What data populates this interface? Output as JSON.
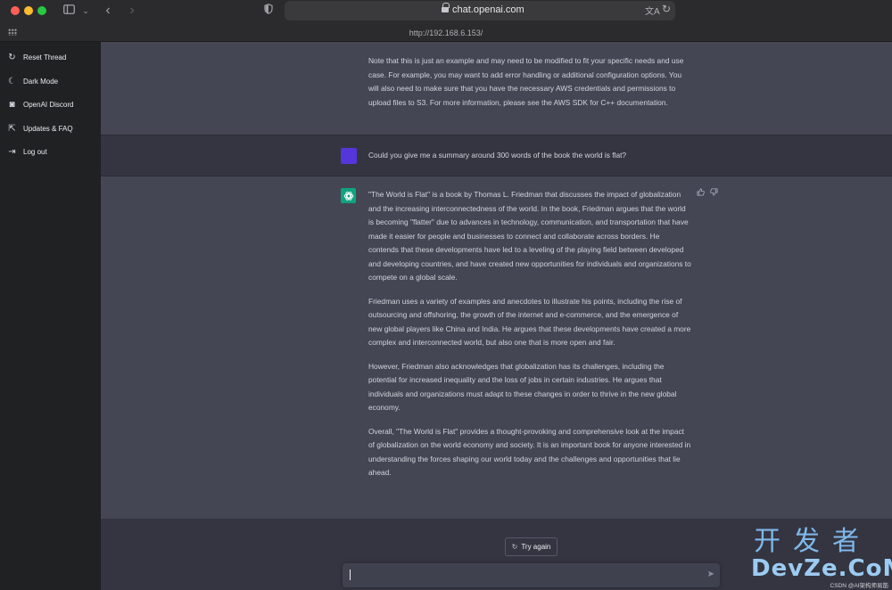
{
  "browser": {
    "url_display": "chat.openai.com",
    "tab_url": "http://192.168.6.153/",
    "icons": [
      "sidebar-toggle-icon",
      "chevron-down-icon",
      "back-icon",
      "forward-icon",
      "shield-icon",
      "lock-icon",
      "translate-icon",
      "reload-icon",
      "grid-icon"
    ]
  },
  "sidebar": {
    "items": [
      {
        "label": "Reset Thread",
        "icon": "↻"
      },
      {
        "label": "Dark Mode",
        "icon": "☾"
      },
      {
        "label": "OpenAI Discord",
        "icon": "◙"
      },
      {
        "label": "Updates & FAQ",
        "icon": "⇱"
      },
      {
        "label": "Log out",
        "icon": "⇥"
      }
    ]
  },
  "chat": {
    "previous_message": "Note that this is just an example and may need to be modified to fit your specific needs and use case. For example, you may want to add error handling or additional configuration options. You will also need to make sure that you have the necessary AWS credentials and permissions to upload files to S3. For more information, please see the AWS SDK for C++ documentation.",
    "user_message": "Could you give me a summary around 300 words of the book the world is flat?",
    "bot_paragraphs": [
      "\"The World is Flat\" is a book by Thomas L. Friedman that discusses the impact of globalization and the increasing interconnectedness of the world. In the book, Friedman argues that the world is becoming \"flatter\" due to advances in technology, communication, and transportation that have made it easier for people and businesses to connect and collaborate across borders. He contends that these developments have led to a leveling of the playing field between developed and developing countries, and have created new opportunities for individuals and organizations to compete on a global scale.",
      "Friedman uses a variety of examples and anecdotes to illustrate his points, including the rise of outsourcing and offshoring, the growth of the internet and e-commerce, and the emergence of new global players like China and India. He argues that these developments have created a more complex and interconnected world, but also one that is more open and fair.",
      "However, Friedman also acknowledges that globalization has its challenges, including the potential for increased inequality and the loss of jobs in certain industries. He argues that individuals and organizations must adapt to these changes in order to thrive in the new global economy.",
      "Overall, \"The World is Flat\" provides a thought-provoking and comprehensive look at the impact of globalization on the world economy and society. It is an important book for anyone interested in understanding the forces shaping our world today and the challenges and opportunities that lie ahead."
    ],
    "try_again_label": "Try again",
    "input_value": ""
  },
  "watermark": {
    "chinese": "开发者",
    "brand": "DevZe.CoM",
    "small": "CSDN @AI架构师易筋"
  },
  "colors": {
    "sidebar_bg": "#202123",
    "main_bg": "#343541",
    "assistant_bg": "#444654",
    "user_avatar": "#5436da",
    "bot_avatar": "#10a37f"
  }
}
